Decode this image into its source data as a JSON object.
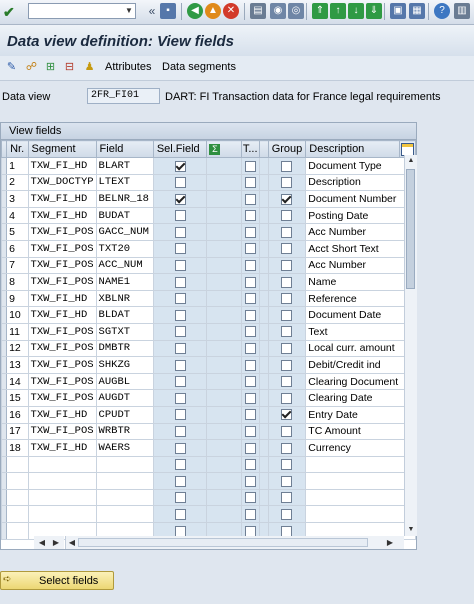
{
  "page_title": "Data view definition: View fields",
  "toolbar": {
    "command_value": "",
    "icons": [
      "check-icon",
      "dropdown-icon",
      "back-double-icon",
      "save-icon",
      "back-icon",
      "exit-icon",
      "cancel-icon",
      "print-icon",
      "find-icon",
      "find-next-icon",
      "first-page-icon",
      "prev-page-icon",
      "next-page-icon",
      "last-page-icon",
      "new-session-icon",
      "shortcut-icon",
      "help-icon",
      "customize-icon"
    ]
  },
  "app_toolbar": {
    "attributes_label": "Attributes",
    "segments_label": "Data segments"
  },
  "data_view": {
    "label": "Data view",
    "value": "2FR_FI01",
    "description": "DART: FI Transaction data for France legal requirements"
  },
  "table": {
    "caption": "View fields",
    "headers": {
      "nr": "Nr.",
      "segment": "Segment",
      "field": "Field",
      "sel_field": "Sel.Field",
      "t": "T...",
      "group": "Group",
      "description": "Description"
    },
    "rows": [
      {
        "nr": "1",
        "segment": "TXW_FI_HD",
        "field": "BLART",
        "sel": true,
        "t": false,
        "group": false,
        "desc": "Document Type"
      },
      {
        "nr": "2",
        "segment": "TXW_DOCTYP",
        "field": "LTEXT",
        "sel": false,
        "t": false,
        "group": false,
        "desc": "Description"
      },
      {
        "nr": "3",
        "segment": "TXW_FI_HD",
        "field": "BELNR_18",
        "sel": true,
        "t": false,
        "group": true,
        "desc": "Document Number"
      },
      {
        "nr": "4",
        "segment": "TXW_FI_HD",
        "field": "BUDAT",
        "sel": false,
        "t": false,
        "group": false,
        "desc": "Posting Date"
      },
      {
        "nr": "5",
        "segment": "TXW_FI_POS",
        "field": "GACC_NUM",
        "sel": false,
        "t": false,
        "group": false,
        "desc": "Acc Number"
      },
      {
        "nr": "6",
        "segment": "TXW_FI_POS",
        "field": "TXT20",
        "sel": false,
        "t": false,
        "group": false,
        "desc": "Acct Short Text"
      },
      {
        "nr": "7",
        "segment": "TXW_FI_POS",
        "field": "ACC_NUM",
        "sel": false,
        "t": false,
        "group": false,
        "desc": "Acc Number"
      },
      {
        "nr": "8",
        "segment": "TXW_FI_POS",
        "field": "NAME1",
        "sel": false,
        "t": false,
        "group": false,
        "desc": "Name"
      },
      {
        "nr": "9",
        "segment": "TXW_FI_HD",
        "field": "XBLNR",
        "sel": false,
        "t": false,
        "group": false,
        "desc": "Reference"
      },
      {
        "nr": "10",
        "segment": "TXW_FI_HD",
        "field": "BLDAT",
        "sel": false,
        "t": false,
        "group": false,
        "desc": "Document Date"
      },
      {
        "nr": "11",
        "segment": "TXW_FI_POS",
        "field": "SGTXT",
        "sel": false,
        "t": false,
        "group": false,
        "desc": "Text"
      },
      {
        "nr": "12",
        "segment": "TXW_FI_POS",
        "field": "DMBTR",
        "sel": false,
        "t": false,
        "group": false,
        "desc": "Local curr. amount"
      },
      {
        "nr": "13",
        "segment": "TXW_FI_POS",
        "field": "SHKZG",
        "sel": false,
        "t": false,
        "group": false,
        "desc": "Debit/Credit ind"
      },
      {
        "nr": "14",
        "segment": "TXW_FI_POS",
        "field": "AUGBL",
        "sel": false,
        "t": false,
        "group": false,
        "desc": "Clearing Document"
      },
      {
        "nr": "15",
        "segment": "TXW_FI_POS",
        "field": "AUGDT",
        "sel": false,
        "t": false,
        "group": false,
        "desc": "Clearing Date"
      },
      {
        "nr": "16",
        "segment": "TXW_FI_HD",
        "field": "CPUDT",
        "sel": false,
        "t": false,
        "group": true,
        "desc": "Entry Date"
      },
      {
        "nr": "17",
        "segment": "TXW_FI_POS",
        "field": "WRBTR",
        "sel": false,
        "t": false,
        "group": false,
        "desc": "TC Amount"
      },
      {
        "nr": "18",
        "segment": "TXW_FI_HD",
        "field": "WAERS",
        "sel": false,
        "t": false,
        "group": false,
        "desc": "Currency"
      },
      {
        "nr": "",
        "segment": "",
        "field": "",
        "sel": false,
        "t": false,
        "group": false,
        "desc": ""
      },
      {
        "nr": "",
        "segment": "",
        "field": "",
        "sel": false,
        "t": false,
        "group": false,
        "desc": ""
      },
      {
        "nr": "",
        "segment": "",
        "field": "",
        "sel": false,
        "t": false,
        "group": false,
        "desc": ""
      },
      {
        "nr": "",
        "segment": "",
        "field": "",
        "sel": false,
        "t": false,
        "group": false,
        "desc": ""
      },
      {
        "nr": "",
        "segment": "",
        "field": "",
        "sel": false,
        "t": false,
        "group": false,
        "desc": ""
      }
    ]
  },
  "select_button": "Select fields",
  "colors": {
    "title": "#1b2a3f",
    "checkbox_col_bg": "#d7e4f0",
    "button": "#ecd774"
  }
}
